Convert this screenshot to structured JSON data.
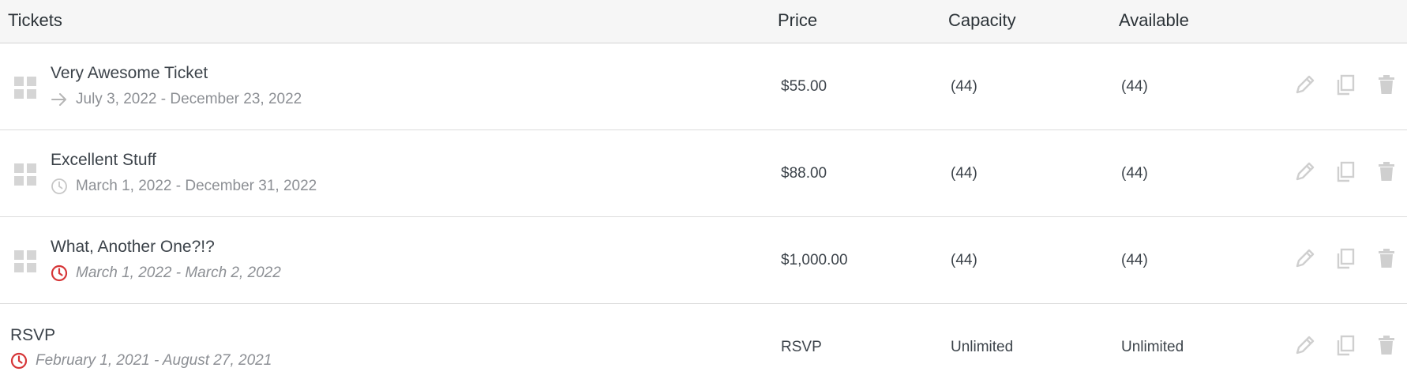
{
  "header": {
    "tickets_label": "Tickets",
    "price_label": "Price",
    "capacity_label": "Capacity",
    "available_label": "Available"
  },
  "colors": {
    "header_bg": "#f6f6f6",
    "muted": "#8c8f94",
    "icon_gray": "#cfcfcf",
    "alert_red": "#d63638"
  },
  "rows": [
    {
      "name": "Very Awesome Ticket",
      "dates": "July 3, 2022 - December 23, 2022",
      "date_icon": "arrow-right-icon",
      "price": "$55.00",
      "capacity": "(44)",
      "available": "(44)"
    },
    {
      "name": "Excellent Stuff",
      "dates": "March 1, 2022 - December 31, 2022",
      "date_icon": "clock-icon",
      "price": "$88.00",
      "capacity": "(44)",
      "available": "(44)"
    },
    {
      "name": "What, Another One?!?",
      "dates": "March 1, 2022 - March 2, 2022",
      "date_icon": "clock-alert-icon",
      "price": "$1,000.00",
      "capacity": "(44)",
      "available": "(44)"
    },
    {
      "name": "RSVP",
      "dates": "February 1, 2021 - August 27, 2021",
      "date_icon": "clock-alert-icon",
      "price": "RSVP",
      "capacity": "Unlimited",
      "available": "Unlimited"
    }
  ]
}
